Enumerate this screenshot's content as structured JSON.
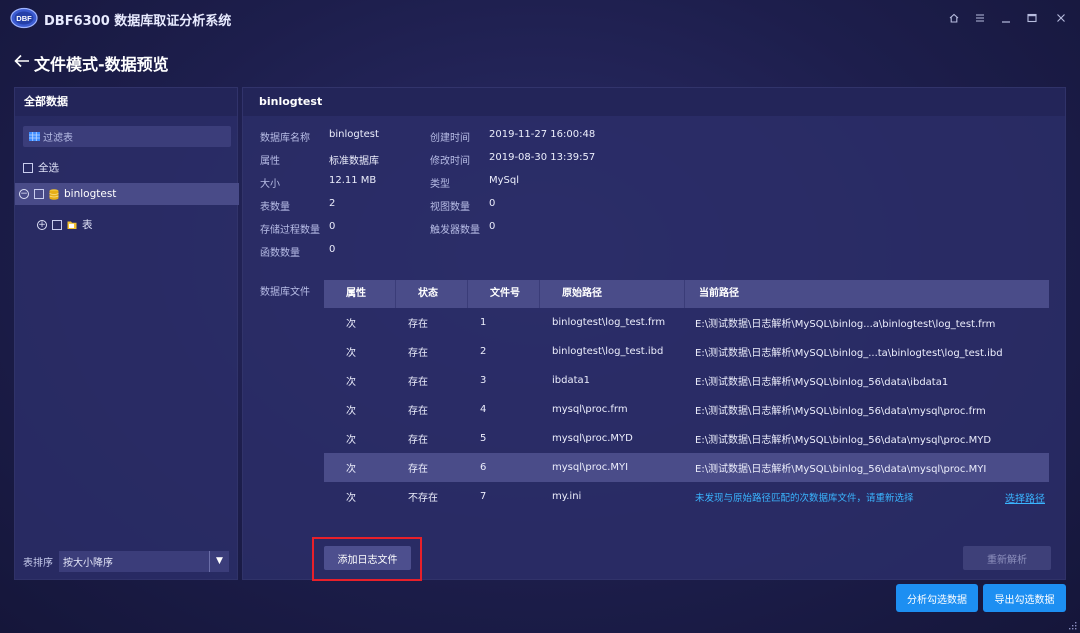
{
  "app": {
    "title": "DBF6300 数据库取证分析系统",
    "logo_text": "DBF"
  },
  "window_controls": [
    "home-icon",
    "menu-icon",
    "minimize-icon",
    "maximize-icon",
    "close-icon"
  ],
  "page": {
    "back_icon": "arrow-left-icon",
    "title": "文件模式-数据预览"
  },
  "left_panel": {
    "header": "全部数据",
    "filter_placeholder": "过滤表",
    "select_all_label": "全选",
    "tree": [
      {
        "label": "binlogtest",
        "icon": "database-icon",
        "expanded": true,
        "selected": true
      },
      {
        "label": "表",
        "icon": "folder-icon",
        "expanded": false
      }
    ],
    "sort": {
      "label": "表排序",
      "value": "按大小降序"
    }
  },
  "detail": {
    "header": "binlogtest",
    "props": [
      {
        "key": "数据库名称",
        "value": "binlogtest"
      },
      {
        "key": "创建时间",
        "value": "2019-11-27 16:00:48"
      },
      {
        "key": "属性",
        "value": "标准数据库"
      },
      {
        "key": "修改时间",
        "value": "2019-08-30 13:39:57"
      },
      {
        "key": "大小",
        "value": "12.11 MB"
      },
      {
        "key": "类型",
        "value": "MySql"
      },
      {
        "key": "表数量",
        "value": "2"
      },
      {
        "key": "视图数量",
        "value": "0"
      },
      {
        "key": "存储过程数量",
        "value": "0"
      },
      {
        "key": "触发器数量",
        "value": "0"
      },
      {
        "key": "函数数量",
        "value": "0"
      }
    ],
    "files_label": "数据库文件",
    "table": {
      "columns": [
        "属性",
        "状态",
        "文件号",
        "原始路径",
        "当前路径"
      ],
      "rows": [
        [
          "次",
          "存在",
          "1",
          "binlogtest\\log_test.frm",
          "E:\\测试数据\\日志解析\\MySQL\\binlog...a\\binlogtest\\log_test.frm"
        ],
        [
          "次",
          "存在",
          "2",
          "binlogtest\\log_test.ibd",
          "E:\\测试数据\\日志解析\\MySQL\\binlog_...ta\\binlogtest\\log_test.ibd"
        ],
        [
          "次",
          "存在",
          "3",
          "ibdata1",
          "E:\\测试数据\\日志解析\\MySQL\\binlog_56\\data\\ibdata1"
        ],
        [
          "次",
          "存在",
          "4",
          "mysql\\proc.frm",
          "E:\\测试数据\\日志解析\\MySQL\\binlog_56\\data\\mysql\\proc.frm"
        ],
        [
          "次",
          "存在",
          "5",
          "mysql\\proc.MYD",
          "E:\\测试数据\\日志解析\\MySQL\\binlog_56\\data\\mysql\\proc.MYD"
        ],
        [
          "次",
          "存在",
          "6",
          "mysql\\proc.MYI",
          "E:\\测试数据\\日志解析\\MySQL\\binlog_56\\data\\mysql\\proc.MYI"
        ],
        [
          "次",
          "不存在",
          "7",
          "my.ini",
          "未发现与原始路径匹配的次数据库文件，请重新选择"
        ]
      ],
      "highlighted_row": 6,
      "select_path_link": "选择路径"
    },
    "add_log_button": "添加日志文件",
    "reparse_button": "重新解析"
  },
  "footer": {
    "analyze_button": "分析勾选数据",
    "export_button": "导出勾选数据"
  },
  "colors": {
    "background": "#1d1e4c",
    "panel": "#2c2e68",
    "accent_blue": "#1d8ff2",
    "link_blue": "#3ab5ff",
    "highlight_red": "#e8202a"
  }
}
